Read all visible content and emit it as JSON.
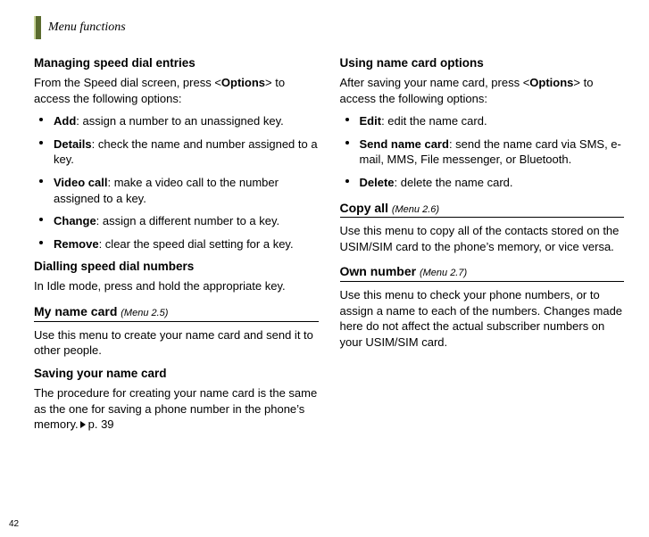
{
  "header": {
    "title": "Menu functions"
  },
  "page_number": "42",
  "left": {
    "h1": "Managing speed dial entries",
    "intro_a": "From the Speed dial screen, press <",
    "intro_b": "Options",
    "intro_c": "> to access the following options:",
    "items": [
      {
        "term": "Add",
        "desc": ": assign a number to an unassigned key."
      },
      {
        "term": "Details",
        "desc": ": check the name and number assigned to a key."
      },
      {
        "term": "Video call",
        "desc": ": make a video call to the number assigned to a key."
      },
      {
        "term": "Change",
        "desc": ": assign a different number to a key."
      },
      {
        "term": "Remove",
        "desc": ": clear the speed dial setting for a key."
      }
    ],
    "h2": "Dialling speed dial numbers",
    "p2": "In Idle mode, press and hold the appropriate key.",
    "sec1_title": "My name card",
    "sec1_menu": "(Menu 2.5)",
    "sec1_p": "Use this menu to create your name card and send it to other people.",
    "h3": "Saving your name card",
    "p3_a": "The procedure for creating your name card is the same as the one for saving a phone number in the phone’s memory.",
    "p3_b": "p. 39"
  },
  "right": {
    "h1": "Using name card options",
    "intro_a": "After saving your name card, press <",
    "intro_b": "Options",
    "intro_c": "> to access the following options:",
    "items": [
      {
        "term": "Edit",
        "desc": ": edit the name card."
      },
      {
        "term": "Send name card",
        "desc": ": send the name card via SMS, e-mail, MMS, File messenger, or Bluetooth."
      },
      {
        "term": "Delete",
        "desc": ": delete the name card."
      }
    ],
    "sec1_title": "Copy all",
    "sec1_menu": "(Menu 2.6)",
    "sec1_p": "Use this menu to copy all of the contacts stored on the USIM/SIM card to the phone’s memory, or vice versa.",
    "sec2_title": "Own number",
    "sec2_menu": "(Menu 2.7)",
    "sec2_p": "Use this menu to check your phone numbers, or to assign a name to each of the numbers. Changes made here do not affect the actual subscriber numbers on your USIM/SIM card."
  }
}
